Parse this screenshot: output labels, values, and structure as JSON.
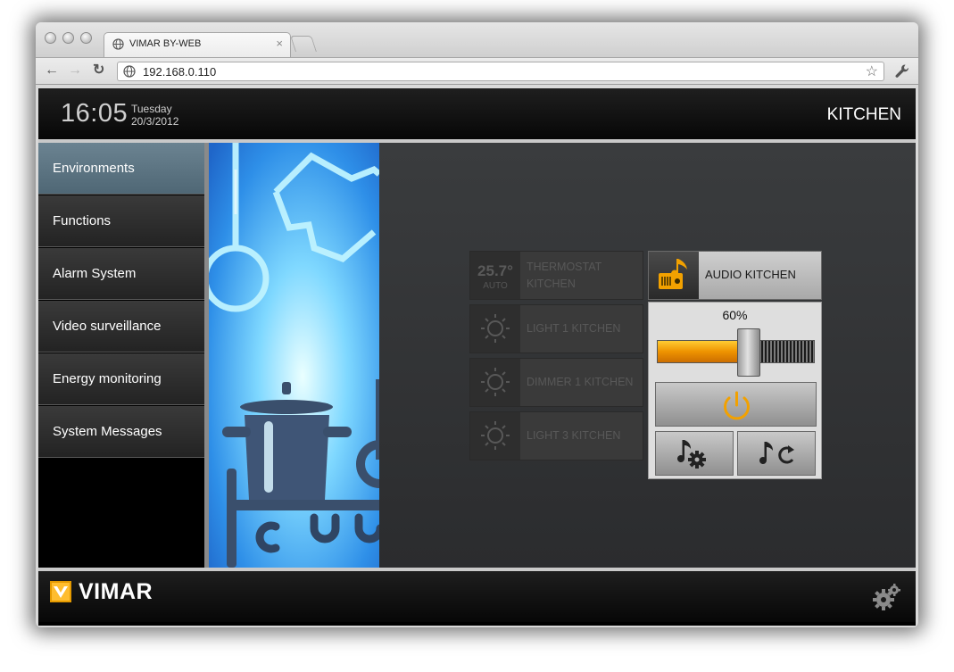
{
  "browser": {
    "tab_title": "VIMAR BY-WEB",
    "tab_close": "×",
    "url": "192.168.0.110",
    "back": "←",
    "forward": "→",
    "reload": "↻",
    "star": "☆"
  },
  "header": {
    "time": "16:05",
    "weekday": "Tuesday",
    "date": "20/3/2012",
    "room": "KITCHEN"
  },
  "sidebar": {
    "items": [
      {
        "label": "Environments",
        "active": true
      },
      {
        "label": "Functions"
      },
      {
        "label": "Alarm System"
      },
      {
        "label": "Video surveillance"
      },
      {
        "label": "Energy monitoring"
      },
      {
        "label": "System Messages"
      }
    ]
  },
  "devices": {
    "thermostat": {
      "temp": "25.7°",
      "mode": "AUTO",
      "line1": "THERMOSTAT",
      "line2": "KITCHEN"
    },
    "light1": {
      "label": "LIGHT 1 KITCHEN"
    },
    "dimmer1": {
      "label": "DIMMER 1 KITCHEN"
    },
    "light3": {
      "label": "LIGHT 3 KITCHEN"
    }
  },
  "audio": {
    "label": "AUDIO KITCHEN",
    "volume_text": "60%",
    "volume": 0.6,
    "icons": {
      "tile": "audio-music-icon",
      "power": "power-icon",
      "settings": "music-settings-icon",
      "source": "music-source-cycle-icon"
    }
  },
  "footer": {
    "brand": "VIMAR",
    "settings_icon": "settings-gears-icon"
  },
  "colors": {
    "accent_orange": "#f2a100",
    "active_nav": "#5d7684",
    "header_bg": "#0b0b0b"
  }
}
